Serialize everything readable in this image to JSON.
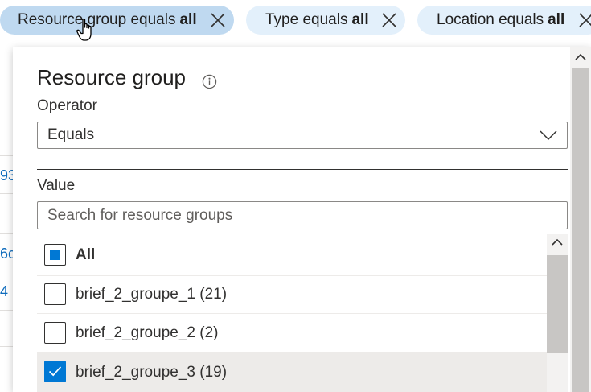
{
  "background": {
    "fragments": [
      "93",
      "6c",
      "4"
    ]
  },
  "filters": [
    {
      "prefix": "Resource group equals",
      "value": "all",
      "active": true
    },
    {
      "prefix": "Type equals",
      "value": "all",
      "active": false
    },
    {
      "prefix": "Location equals",
      "value": "all",
      "active": false
    }
  ],
  "panel": {
    "title": "Resource group",
    "operator_label": "Operator",
    "operator_value": "Equals",
    "value_label": "Value",
    "search_placeholder": "Search for resource groups",
    "items": [
      {
        "label": "All",
        "state": "indeterminate"
      },
      {
        "label": "brief_2_groupe_1 (21)",
        "state": "unchecked"
      },
      {
        "label": "brief_2_groupe_2 (2)",
        "state": "unchecked"
      },
      {
        "label": "brief_2_groupe_3 (19)",
        "state": "checked"
      }
    ]
  },
  "colors": {
    "accent": "#0078d4",
    "active_pill": "#bfd9f0",
    "inactive_pill": "#e3f0fb",
    "link": "#0f6cbd"
  }
}
